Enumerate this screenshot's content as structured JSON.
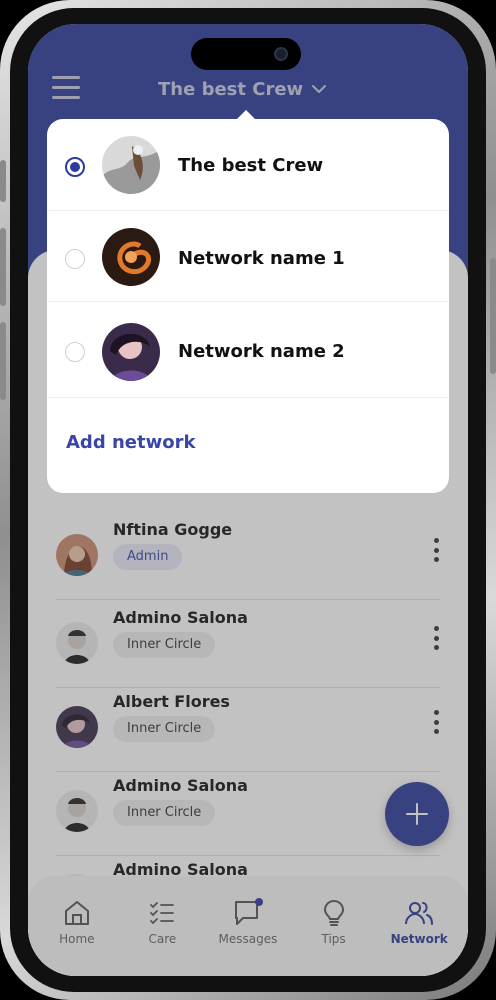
{
  "header": {
    "network_title": "The best Crew"
  },
  "dropdown": {
    "networks": [
      {
        "name": "The best Crew",
        "selected": true
      },
      {
        "name": "Network name 1",
        "selected": false
      },
      {
        "name": "Network name 2",
        "selected": false
      }
    ],
    "add_label": "Add network"
  },
  "members": [
    {
      "name": "Nftina Gogge",
      "role": "Admin"
    },
    {
      "name": "Admino Salona",
      "role": "Inner Circle"
    },
    {
      "name": "Albert Flores",
      "role": "Inner Circle"
    },
    {
      "name": "Admino Salona",
      "role": "Inner Circle"
    },
    {
      "name": "Admino Salona",
      "role": ""
    }
  ],
  "nav": {
    "home": "Home",
    "care": "Care",
    "messages": "Messages",
    "tips": "Tips",
    "network": "Network",
    "active": "Network"
  },
  "colors": {
    "brand": "#2d3b9c",
    "accent_text": "#3a45a8"
  }
}
